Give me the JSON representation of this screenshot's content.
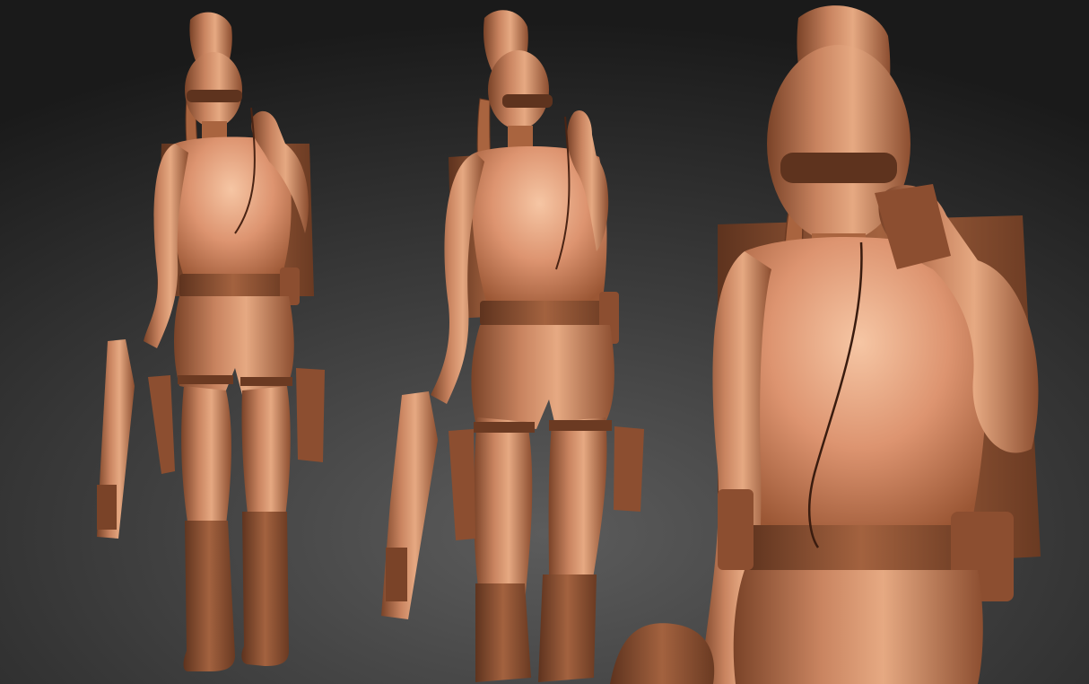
{
  "scene": {
    "type": "3d-sculpt-render",
    "views": [
      "full-body-front",
      "full-body-three-quarter",
      "close-up-torso"
    ],
    "colors": {
      "clay_base": "#b7724c",
      "clay_light": "#e2a27a",
      "clay_highlight": "#f4c2a0",
      "clay_shadow": "#6b3a22",
      "background_center": "#5c5c5c",
      "background_edge": "#1a1a1a"
    }
  }
}
